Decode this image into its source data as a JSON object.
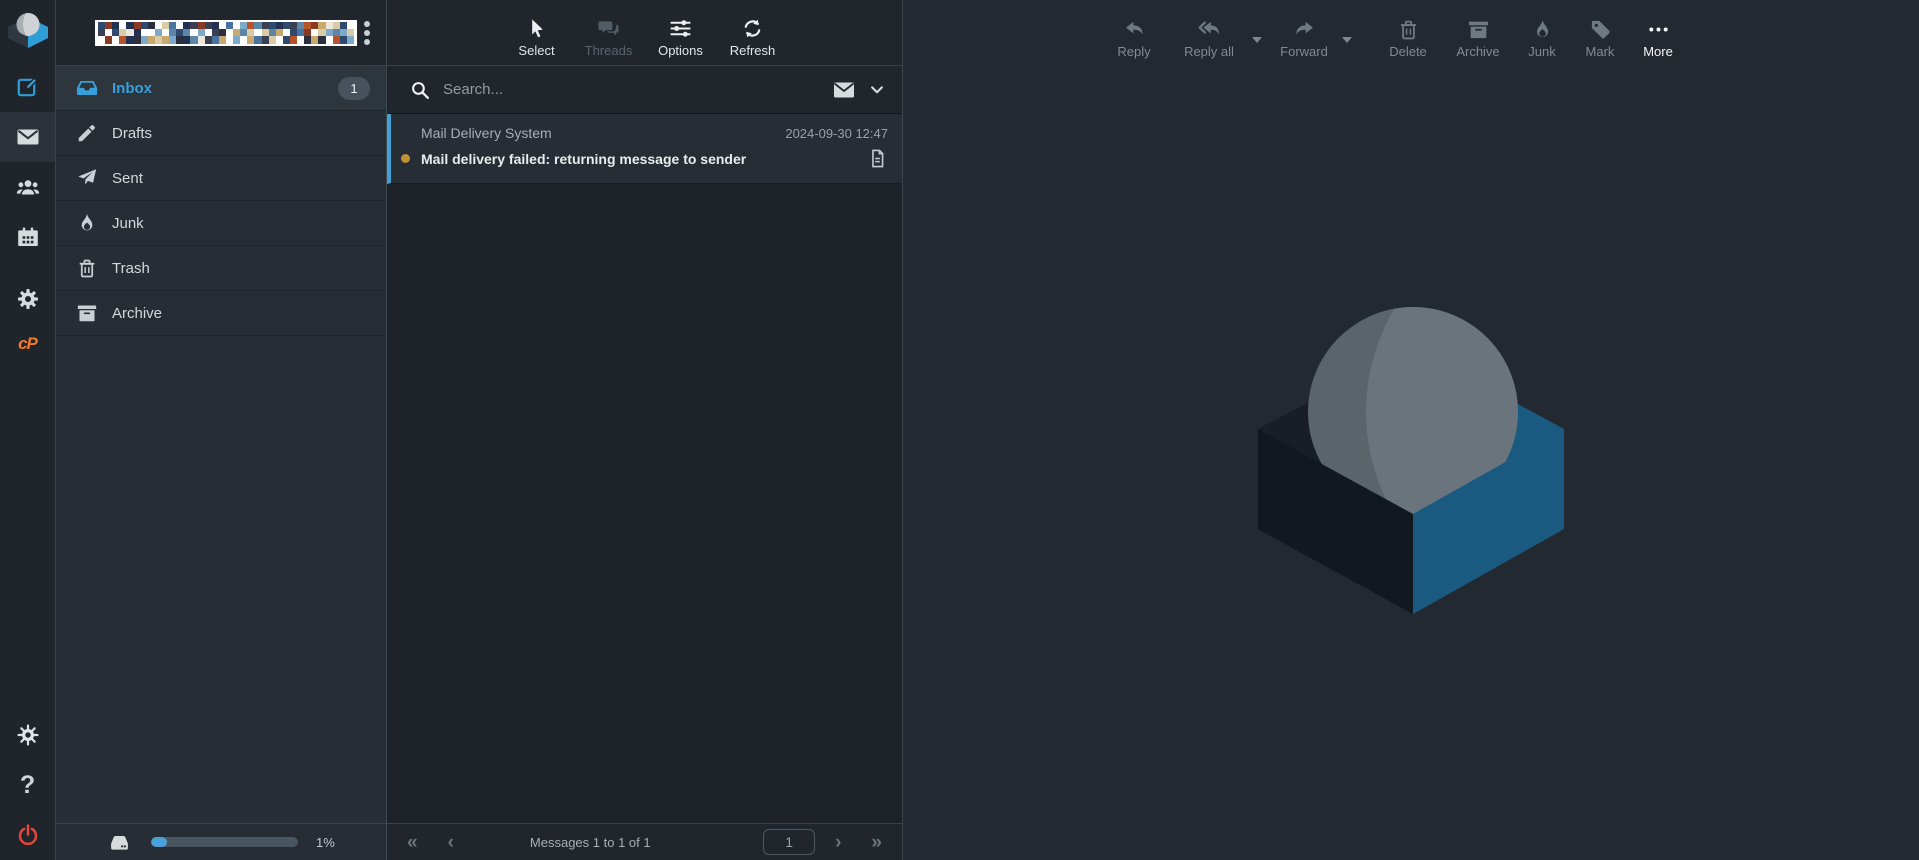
{
  "rail": {
    "top_icons": [
      "roundcube-logo",
      "compose-icon",
      "mail-icon",
      "contacts-icon",
      "calendar-icon",
      "settings-gear-icon",
      "cpanel-icon"
    ],
    "active_item": "mail",
    "cpanel_label": "cP",
    "bottom_icons": [
      "sun-icon",
      "help-icon",
      "power-icon"
    ],
    "help_label": "?"
  },
  "folders": {
    "account_email_redacted": true,
    "items": [
      {
        "label": "Inbox",
        "icon": "inbox-icon",
        "badge": "1",
        "active": true
      },
      {
        "label": "Drafts",
        "icon": "pencil-icon",
        "active": false
      },
      {
        "label": "Sent",
        "icon": "paper-plane-icon",
        "active": false
      },
      {
        "label": "Junk",
        "icon": "flame-icon",
        "active": false
      },
      {
        "label": "Trash",
        "icon": "trash-icon",
        "active": false
      },
      {
        "label": "Archive",
        "icon": "archive-box-icon",
        "active": false
      }
    ],
    "storage": {
      "icon": "hard-disk-icon",
      "fill_percent": 11,
      "percent_label": "1%"
    }
  },
  "message_list": {
    "toolbar": [
      {
        "label": "Select",
        "icon": "cursor-icon",
        "enabled": true
      },
      {
        "label": "Threads",
        "icon": "chat-bubbles-icon",
        "enabled": false
      },
      {
        "label": "Options",
        "icon": "sliders-icon",
        "enabled": true
      },
      {
        "label": "Refresh",
        "icon": "refresh-icon",
        "enabled": true
      }
    ],
    "search": {
      "placeholder": "Search...",
      "scope_icon": "envelope-icon",
      "dropdown_icon": "chevron-down-icon"
    },
    "messages": [
      {
        "sender": "Mail Delivery System",
        "date": "2024-09-30 12:47",
        "subject": "Mail delivery failed: returning message to sender",
        "unread": true,
        "selected": true,
        "attachment_icon": "document-icon"
      }
    ],
    "pagination": {
      "first_label": "«",
      "prev_label": "‹",
      "status": "Messages 1 to 1 of 1",
      "page_value": "1",
      "next_label": "›",
      "last_label": "»"
    }
  },
  "content_pane": {
    "toolbar": [
      {
        "label": "Reply",
        "icon": "reply-icon",
        "enabled": false,
        "dropdown": false
      },
      {
        "label": "Reply all",
        "icon": "reply-all-icon",
        "enabled": false,
        "dropdown": true
      },
      {
        "label": "Forward",
        "icon": "forward-icon",
        "enabled": false,
        "dropdown": true
      },
      {
        "label": "Delete",
        "icon": "trash-icon",
        "enabled": false,
        "dropdown": false
      },
      {
        "label": "Archive",
        "icon": "archive-box-icon",
        "enabled": false,
        "dropdown": false
      },
      {
        "label": "Junk",
        "icon": "flame-icon",
        "enabled": false,
        "dropdown": false
      },
      {
        "label": "Mark",
        "icon": "tag-icon",
        "enabled": false,
        "dropdown": false
      },
      {
        "label": "More",
        "icon": "ellipsis-icon",
        "enabled": true,
        "dropdown": false
      }
    ],
    "watermark_icon": "roundcube-logo-watermark"
  },
  "colors": {
    "accent_blue": "#369fd9",
    "unread_dot": "#c09236",
    "power_red": "#e8453c",
    "cpanel_orange": "#f4782a",
    "badge_bg": "#47525c",
    "storage_fill": "#4aa0d9"
  }
}
